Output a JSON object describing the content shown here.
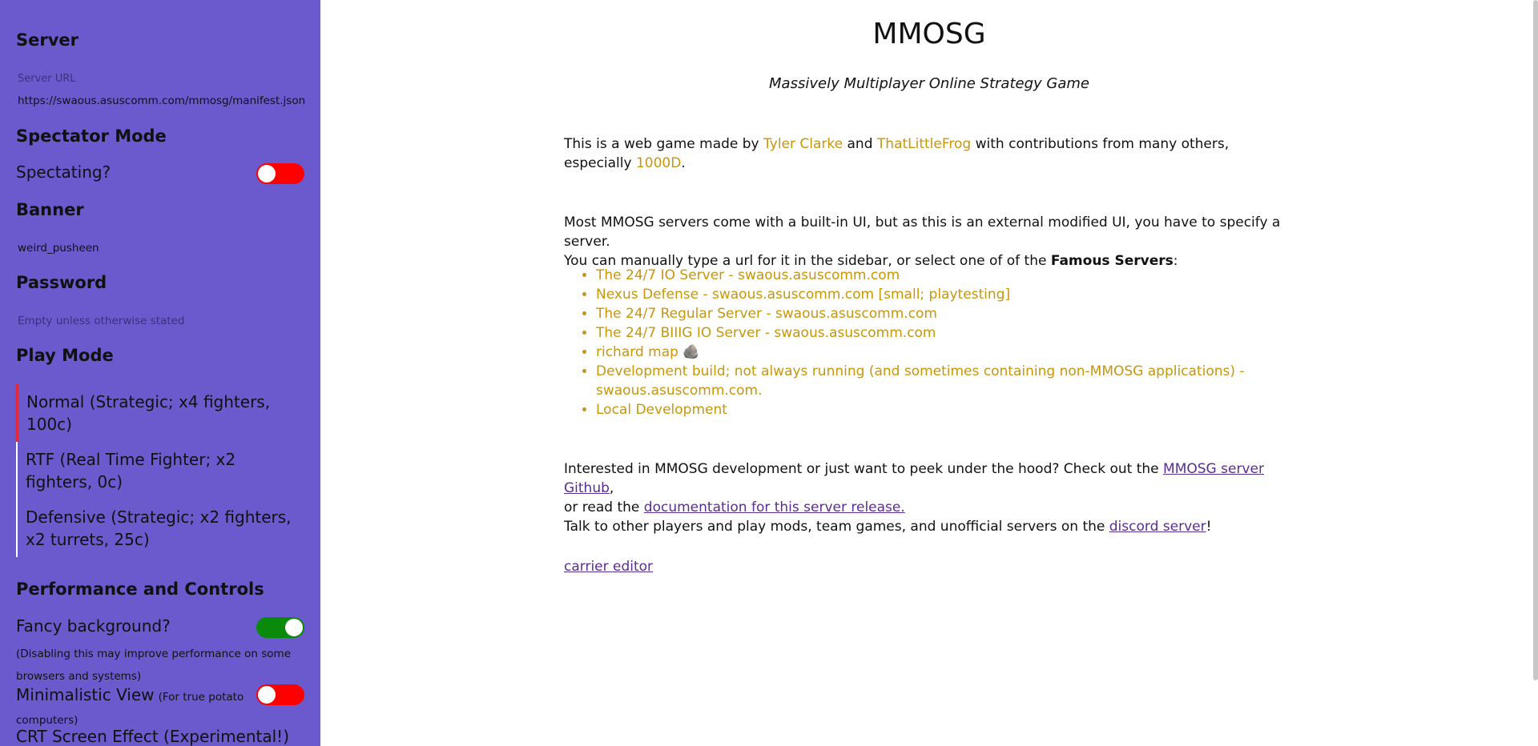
{
  "sidebar": {
    "server_heading": "Server",
    "server_url_label": "Server URL",
    "server_url_value": "https://swaous.asuscomm.com/mmosg/manifest.json",
    "spectator_heading": "Spectator Mode",
    "spectating_label": "Spectating?",
    "spectating_on": false,
    "banner_heading": "Banner",
    "banner_value": "weird_pusheen",
    "password_heading": "Password",
    "password_placeholder": "Empty unless otherwise stated",
    "play_mode_heading": "Play Mode",
    "play_modes": [
      {
        "label": "Normal (Strategic; x4 fighters, 100c)",
        "selected": true
      },
      {
        "label": "RTF (Real Time Fighter; x2 fighters, 0c)",
        "selected": false
      },
      {
        "label": "Defensive (Strategic; x2 fighters, x2 turrets, 25c)",
        "selected": false
      }
    ],
    "performance_heading": "Performance and Controls",
    "fancy_bg_label": "Fancy background?",
    "fancy_bg_on": true,
    "fancy_bg_note": "(Disabling this may improve performance on some browsers and systems)",
    "minimal_label": "Minimalistic View",
    "minimal_note": "(For true potato computers)",
    "minimal_on": false,
    "crt_label": "CRT Screen Effect (Experimental!)"
  },
  "main": {
    "title": "MMOSG",
    "subtitle": "Massively Multiplayer Online Strategy Game",
    "intro_prefix": "This is a web game made by ",
    "author1": "Tyler Clarke",
    "and": " and ",
    "author2": "ThatLittleFrog",
    "intro_middle": " with contributions from many others, especially ",
    "author3": "1000D",
    "intro_end": ".",
    "servers_p1": "Most MMOSG servers come with a built-in UI, but as this is an external modified UI, you have to specify a server.",
    "servers_p2_prefix": "You can manually type a url for it in the sidebar, or select one of of the ",
    "famous_servers": "Famous Servers",
    "servers_p2_end": ":",
    "servers": [
      "The 24/7 IO Server - swaous.asuscomm.com",
      "Nexus Defense - swaous.asuscomm.com [small; playtesting]",
      "The 24/7 Regular Server - swaous.asuscomm.com",
      "The 24/7 BIIIG IO Server - swaous.asuscomm.com",
      "richard map 🪨",
      "Development build; not always running (and sometimes containing non-MMOSG applications) - swaous.asuscomm.com.",
      "Local Development"
    ],
    "dev_prefix": "Interested in MMOSG development or just want to peek under the hood? Check out the ",
    "github_link": "MMOSG server Github",
    "dev_middle": ",",
    "dev_line2_prefix": "or read the ",
    "docs_link": "documentation for this server release.",
    "discord_prefix": "Talk to other players and play mods, team games, and unofficial servers on the ",
    "discord_link": "discord server",
    "discord_end": "!",
    "carrier_link": "carrier editor"
  }
}
